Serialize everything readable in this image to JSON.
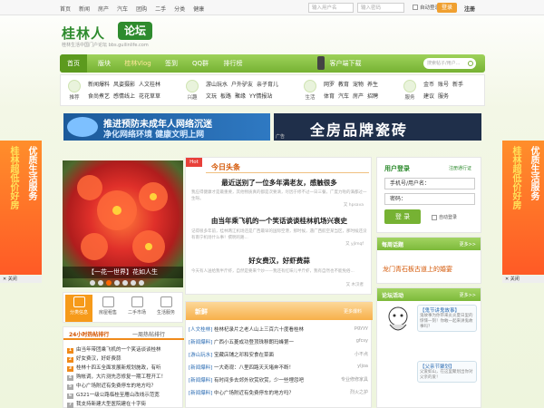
{
  "topbar": {
    "nav": [
      "首页",
      "新闻",
      "房产",
      "汽车",
      "团购",
      "二手",
      "分类",
      "健康"
    ],
    "username_placeholder": "输入用户名",
    "password_placeholder": "输入密码",
    "auto_login": "自动登录",
    "login_label": "登录",
    "register_label": "注册"
  },
  "logo": {
    "text": "桂林人",
    "badge": "论坛",
    "subtitle": "桂林生活中国门户论坛 bbs.guilinlife.com"
  },
  "mainnav": {
    "items": [
      "首页",
      "版块",
      "桂林Vlog",
      "签到",
      "QQ群",
      "排行榜"
    ],
    "client_download": "客户端下载",
    "search_placeholder": "搜索帖子/用户..."
  },
  "channels": [
    {
      "icon": "recommend-icon",
      "label": "推荐",
      "rows": [
        [
          "新闻爆料",
          "风姿摄影",
          "人文桂林"
        ],
        [
          "食尚煮艺",
          "感情线上",
          "花花草草"
        ]
      ]
    },
    {
      "icon": "interest-icon",
      "label": "兴趣",
      "rows": [
        [
          "游山玩水",
          "户外驴友",
          "亲子育儿"
        ],
        [
          "文玩",
          "板路",
          "聚缘",
          "YY情报站"
        ]
      ]
    },
    {
      "icon": "life-icon",
      "label": "生活",
      "rows": [
        [
          "网罗",
          "教育",
          "宠物",
          "养生"
        ],
        [
          "体育",
          "汽车",
          "房产",
          "招聘"
        ]
      ]
    },
    {
      "icon": "service-icon",
      "label": "服务",
      "rows": [
        [
          "金币",
          "账号",
          "新手"
        ],
        [
          "建议",
          "服务"
        ]
      ]
    }
  ],
  "banner1": {
    "line1": "推进预防未成年人网络沉迷",
    "line2": "净化网络环境  健康文明上网"
  },
  "banner2": {
    "text": "全房品牌瓷砖",
    "tag": "广告"
  },
  "sidead": {
    "left_text": "桂林超低价好房",
    "right_text": "优质生活服务",
    "tag": "广告",
    "close": "关闭"
  },
  "slide": {
    "caption": "【一花一世界】花如人生"
  },
  "tiles": [
    {
      "icon": "category-icon",
      "label": "分类信息"
    },
    {
      "icon": "house-icon",
      "label": "房屋租售"
    },
    {
      "icon": "market-icon",
      "label": "二手市场"
    },
    {
      "icon": "life-service-icon",
      "label": "生活服务"
    }
  ],
  "rank": {
    "tab1": "24小时热帖排行",
    "tab2": "一周热帖排行",
    "items": [
      "由当年带团乘飞机的一个笑话谈谈桂林",
      "好女费汉，好虾费蒜",
      "桂林十四五全面发展新规划施政，有听",
      "购帐调，大片测先恋修复一期工程开工！",
      "中心广场附近有免费停车的地方吗？",
      "G321一级公路临桂至雁山改线示范宽",
      "我支持新建大型医院建在十字街"
    ]
  },
  "headline": {
    "hot": "Hot",
    "title": "今日头条",
    "articles": [
      {
        "title": "最近送别了一位多年满老友，感触很多",
        "summary": "我应得健康才是最重要，其他物质真的都是次要滴，尽因于修不过一日三餐，广度力啦的满都过一生呀。",
        "author": "又 hpsava"
      },
      {
        "title": "由当年乘飞机的一个笑话谈谈桂林机场兴衰史",
        "summary": "记得很多年前，桂林两江机场还是广西最早的国际空港，那时候，遇广西航空某当区，那时候还没有南宁机场什么事！撰明的路...",
        "author": "又 yjlmqf"
      },
      {
        "title": "好女费汉，好虾费蒜",
        "summary": "今天有人送给我半斤虾，自然是要来个炒——我还有红味儿半斤虾，我有自然也不能免俗...",
        "author": "又 木汉者"
      }
    ]
  },
  "news": {
    "title": "新鲜",
    "more": "更多爆料",
    "items": [
      {
        "cat": "[人文桂林]",
        "text": "桂林杞录片之老人山上三百六十度看桂林",
        "user": "pgyyy"
      },
      {
        "cat": "[新闻爆料]",
        "text": "广西小五菱成功登顶珠穆朗玛峰第一",
        "user": "gfcsy"
      },
      {
        "cat": "[游山玩水]",
        "text": "宝藏店铺之邓和安食在菜面",
        "user": "小不点"
      },
      {
        "cat": "[新闻爆料]",
        "text": "一大奇观：八里四路天天堵奔不断！",
        "user": "yljoa"
      },
      {
        "cat": "[新闻爆料]",
        "text": "有时间多去郊外欣赏欣赏，少一些埋怨吧",
        "user": "专业修修家具"
      },
      {
        "cat": "[新闻爆料]",
        "text": "中心广场附近有免费停车的地方吗？",
        "user": "烈火之护"
      }
    ]
  },
  "login": {
    "title": "用户登录",
    "fast": "注册通行证",
    "phone_placeholder": "手机号/用户名：",
    "password_placeholder": "密码：",
    "button": "登 录",
    "auto": "自动登录"
  },
  "notice": {
    "title": "每周话题",
    "more": "更多>>",
    "text": "龙门青石板古道上的婚宴"
  },
  "forum": {
    "title": "论坛活动",
    "more": "更多>>",
    "activities": [
      {
        "title": "【鬼节讲鬼故事】",
        "desc": "鬼故事为你带来炎炎夏日里的惊悚一刻！你敢一起来讲鬼故事吗？"
      },
      {
        "title": "【父亲节聚划】",
        "desc": "父爱如山，在这里聚划出你对父亲的爱！"
      }
    ]
  },
  "colors": {
    "green": "#76b233",
    "orange": "#f08a1a",
    "red": "#e8403a"
  }
}
